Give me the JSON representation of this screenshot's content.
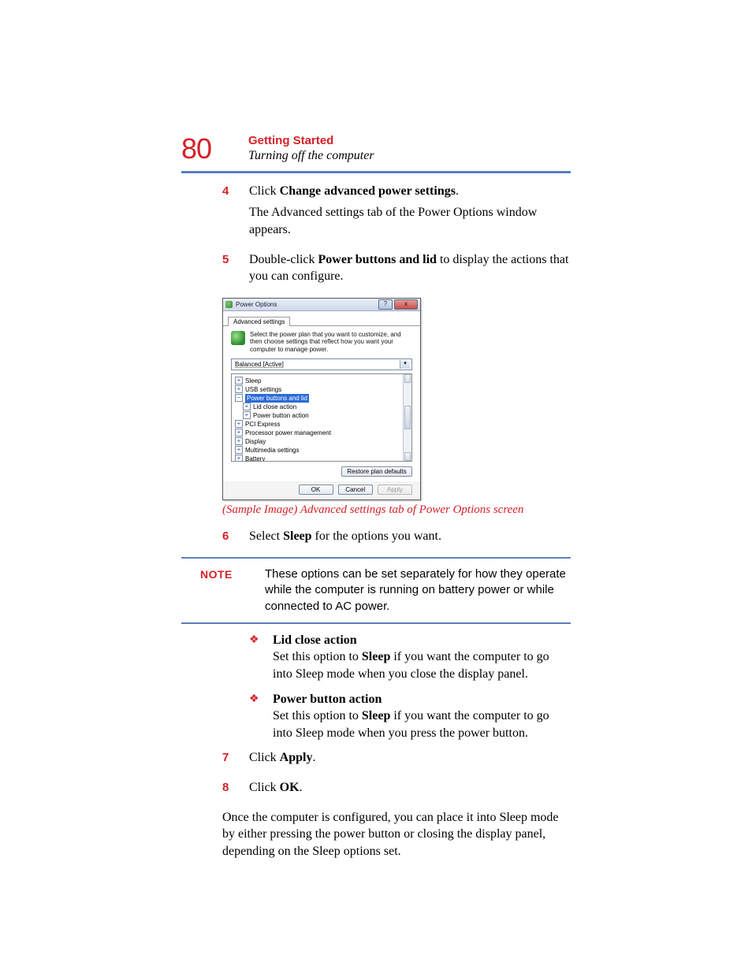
{
  "page_number": "80",
  "header": {
    "chapter": "Getting Started",
    "section": "Turning off the computer"
  },
  "steps": {
    "s4": {
      "num": "4",
      "line1_a": "Click ",
      "line1_b": "Change advanced power settings",
      "line1_c": ".",
      "line2": "The Advanced settings tab of the Power Options window appears."
    },
    "s5": {
      "num": "5",
      "a": "Double-click ",
      "b": "Power buttons and lid",
      "c": " to display the actions that you can configure."
    },
    "s6": {
      "num": "6",
      "a": "Select ",
      "b": "Sleep",
      "c": " for the options you want."
    },
    "s7": {
      "num": "7",
      "a": "Click ",
      "b": "Apply",
      "c": "."
    },
    "s8": {
      "num": "8",
      "a": "Click ",
      "b": "OK",
      "c": "."
    }
  },
  "caption": "(Sample Image) Advanced settings tab of Power Options screen",
  "note": {
    "label": "NOTE",
    "text": "These options can be set separately for how they operate while the computer is running on battery power or while connected to AC power."
  },
  "bullets": {
    "b1": {
      "title": "Lid close action",
      "a": "Set this option to ",
      "b": "Sleep",
      "c": " if you want the computer to go into Sleep mode when you close the display panel."
    },
    "b2": {
      "title": "Power button action",
      "a": "Set this option to ",
      "b": "Sleep",
      "c": " if you want the computer to go into Sleep mode when you press the power button."
    }
  },
  "outro": "Once the computer is configured, you can place it into Sleep mode by either pressing the power button or closing the display panel, depending on the Sleep options set.",
  "dialog": {
    "title": "Power Options",
    "help": "?",
    "close": "x",
    "tab": "Advanced settings",
    "info": "Select the power plan that you want to customize, and then choose settings that reflect how you want your computer to manage power.",
    "plan": "Balanced [Active]",
    "tree": {
      "sleep": "Sleep",
      "usb": "USB settings",
      "pbl": "Power buttons and lid",
      "lid": "Lid close action",
      "pba": "Power button action",
      "pci": "PCI Express",
      "ppm": "Processor power management",
      "display": "Display",
      "mm": "Multimedia settings",
      "battery": "Battery"
    },
    "restore": "Restore plan defaults",
    "ok": "OK",
    "cancel": "Cancel",
    "apply": "Apply"
  }
}
